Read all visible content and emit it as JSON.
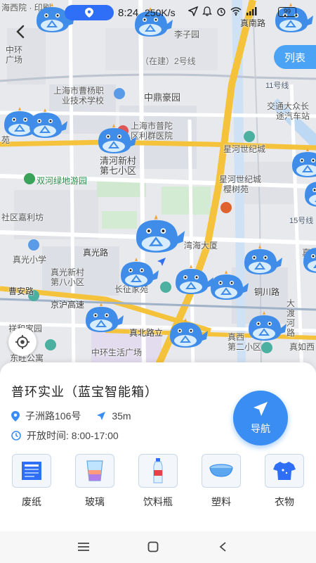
{
  "status_bar": {
    "time": "8:24",
    "net_speed": "250K/s",
    "battery": "99"
  },
  "header": {
    "back_icon": "chevron-left-icon",
    "list_button": "列表"
  },
  "map": {
    "labels": {
      "top_left_cut": "海西院 · 印刷",
      "lizi": "李子园",
      "zhenan": "真南路",
      "zhonghuan": "中环",
      "guangchang": "广场",
      "zaijian": "（在建）2号线",
      "liyuan": "",
      "caoyang": "上海市曹杨职",
      "caoyang2": "业技术学校",
      "zhongding": "中鼎豪园",
      "line11": "11号线",
      "jiaotong": "交通大众长",
      "tuqi": "途汽车站",
      "putuo1": "上海市普陀",
      "putuo2": "区利群医院",
      "qingxi1": "清河新村",
      "qingxi2": "第七小区",
      "xingguang": "星河世纪城",
      "xingguang2": "星河世纪城",
      "yingshu": "樱树苑",
      "shuanghe": "双河绿地游园",
      "jiali": "社区嘉利坊",
      "line15": "15号线",
      "wanhai": "湾海大厦",
      "zhenguang": "真光路",
      "zhenguangxx": "真光小学",
      "zgxc1": "真光新村",
      "zgxc2": "第八小区",
      "changzheng": "长征家苑",
      "tongchuan": "铜川路",
      "caoan": "曹安路",
      "jinghu": "京沪高速",
      "dadu1": "大",
      "dadu2": "渡",
      "dadu3": "河",
      "dadu4": "路",
      "xiangjia": "祥和家园",
      "zhenbei": "真北路",
      "zhenbeili": "真北路立",
      "zhenxi1": "真西",
      "zhenxi2": "第二小区",
      "zhenru": "真如西",
      "zhonghuanlife": "中环生活广场",
      "dongwang": "东旺公寓",
      "meiyuan": "苑",
      "zhenrux": "真如"
    },
    "whale_icon": "whale-recycle-station-icon"
  },
  "station": {
    "name": "普环实业（蓝宝智能箱）",
    "address": "子洲路106号",
    "distance": "35m",
    "hours": "开放时间: 8:00-17:00",
    "nav_label": "导航"
  },
  "categories": [
    {
      "label": "废纸",
      "icon": "newspaper-icon"
    },
    {
      "label": "玻璃",
      "icon": "glass-cup-icon"
    },
    {
      "label": "饮料瓶",
      "icon": "bottle-icon"
    },
    {
      "label": "塑料",
      "icon": "plastic-basin-icon"
    },
    {
      "label": "衣物",
      "icon": "tshirt-icon"
    }
  ],
  "colors": {
    "accent": "#3a8ef3",
    "list_button": "#4aa3f4",
    "main_road": "#f5c33b"
  }
}
